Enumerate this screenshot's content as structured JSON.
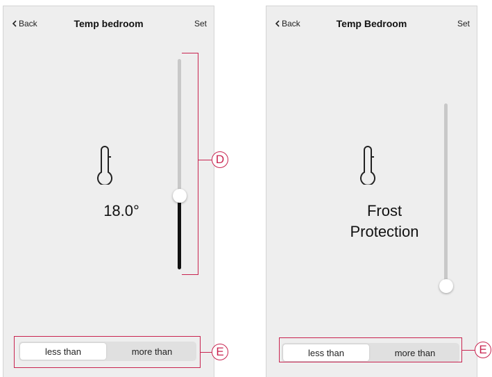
{
  "screens": [
    {
      "back_label": "Back",
      "title": "Temp bedroom",
      "set_label": "Set",
      "temperature": "18.0°",
      "slider_level": 0.35,
      "segment": {
        "options": [
          "less than",
          "more than"
        ],
        "selected": "less than"
      }
    },
    {
      "back_label": "Back",
      "title": "Temp Bedroom",
      "set_label": "Set",
      "mode_line1": "Frost",
      "mode_line2": "Protection",
      "slider_level": 0.0,
      "segment": {
        "options": [
          "less than",
          "more than"
        ],
        "selected": "less than"
      }
    }
  ],
  "callouts": {
    "slider": "D",
    "segment": "E"
  },
  "colors": {
    "callout": "#c8234f",
    "screen_bg": "#eeeeee",
    "slider_fill": "#111111",
    "slider_track": "#c8c8c8"
  },
  "icons": [
    "chevron-left-icon",
    "thermometer-icon"
  ]
}
